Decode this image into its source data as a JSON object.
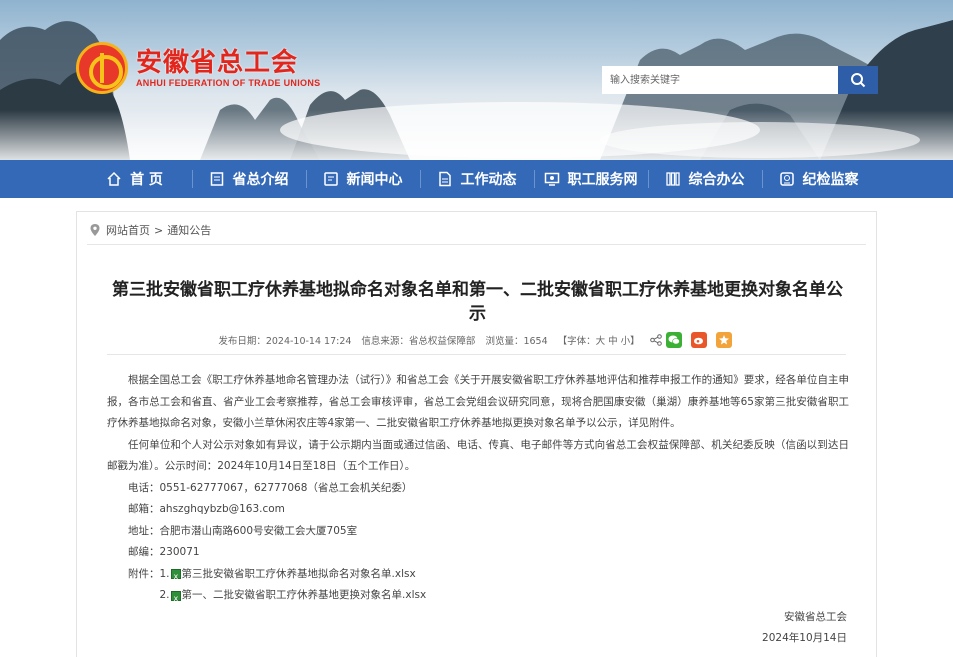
{
  "header": {
    "logo_cn": "安徽省总工会",
    "logo_en": "ANHUI FEDERATION OF TRADE UNIONS",
    "search_placeholder": "输入搜索关键字"
  },
  "nav": {
    "items": [
      {
        "label": "首 页",
        "icon": "home-icon"
      },
      {
        "label": "省总介绍",
        "icon": "document-icon"
      },
      {
        "label": "新闻中心",
        "icon": "news-icon"
      },
      {
        "label": "工作动态",
        "icon": "file-icon"
      },
      {
        "label": "职工服务网",
        "icon": "monitor-icon"
      },
      {
        "label": "综合办公",
        "icon": "books-icon"
      },
      {
        "label": "纪检监察",
        "icon": "badge-icon"
      }
    ]
  },
  "breadcrumb": {
    "home": "网站首页",
    "separator": ">",
    "current": "通知公告"
  },
  "article": {
    "title": "第三批安徽省职工疗休养基地拟命名对象名单和第一、二批安徽省职工疗休养基地更换对象名单公示",
    "meta": {
      "date": "发布日期：2024-10-14 17:24",
      "source": "信息来源：省总权益保障部",
      "views": "浏览量：1654",
      "font": "【字体：大 中 小】"
    },
    "paragraph1": "根据全国总工会《职工疗休养基地命名管理办法（试行）》和省总工会《关于开展安徽省职工疗休养基地评估和推荐申报工作的通知》要求，经各单位自主申报，各市总工会和省直、省产业工会考察推荐，省总工会审核评审，省总工会党组会议研究同意，现将合肥国康安徽（巢湖）康养基地等65家第三批安徽省职工疗休养基地拟命名对象，安徽小兰草休闲农庄等4家第一、二批安徽省职工疗休养基地拟更换对象名单予以公示，详见附件。",
    "paragraph2": "任何单位和个人对公示对象如有异议，请于公示期内当面或通过信函、电话、传真、电子邮件等方式向省总工会权益保障部、机关纪委反映（信函以到达日邮戳为准）。公示时间：2024年10月14日至18日（五个工作日）。",
    "phone": "电话：0551-62777067，62777068（省总工会机关纪委）",
    "email": "邮箱：ahszghqybzb@163.com",
    "address": "地址：合肥市潜山南路600号安徽工会大厦705室",
    "postcode": "邮编：230071",
    "attach_label": "附件：",
    "attachments": [
      {
        "prefix": "1.",
        "name": "第三批安徽省职工疗休养基地拟命名对象名单.xlsx"
      },
      {
        "prefix": "2.",
        "name": "第一、二批安徽省职工疗休养基地更换对象名单.xlsx"
      }
    ],
    "signature": "安徽省总工会",
    "sign_date": "2024年10月14日"
  },
  "colors": {
    "nav_bg": "#3469b8",
    "logo_red": "#e3261c",
    "search_btn": "#2e5ea8",
    "wechat": "#3cb034",
    "weibo": "#e8562a",
    "favorite": "#f2a33a"
  }
}
